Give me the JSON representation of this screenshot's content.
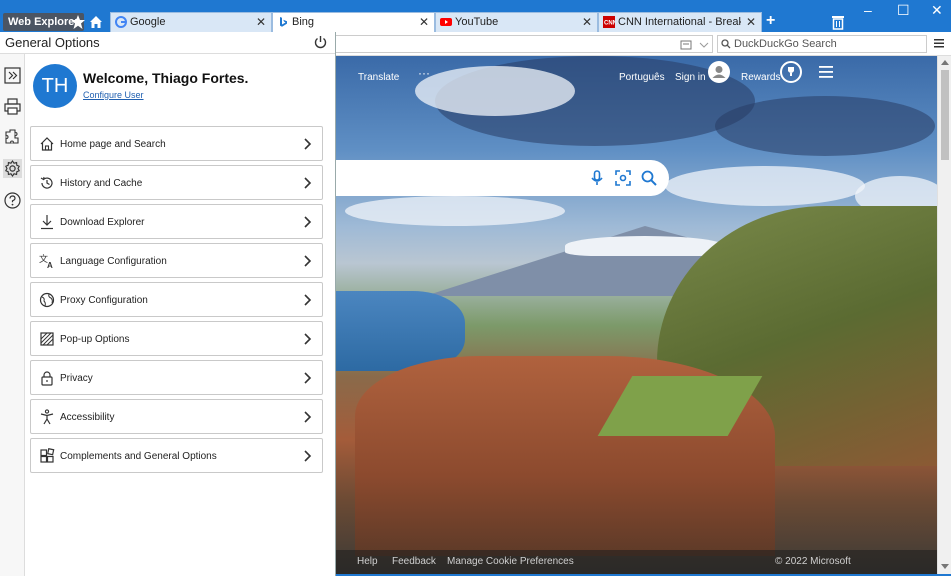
{
  "titlebar": {
    "app_label": "Web Explorer",
    "new_tab": "+",
    "window_controls": [
      "–",
      "☐",
      "✕"
    ]
  },
  "tabs": [
    {
      "label": "Google",
      "favicon": "google-favicon",
      "active": false
    },
    {
      "label": "Bing",
      "favicon": "bing-favicon",
      "active": true
    },
    {
      "label": "YouTube",
      "favicon": "youtube-favicon",
      "active": false
    },
    {
      "label": "CNN International - Breaking News",
      "favicon": "cnn-favicon",
      "active": false
    }
  ],
  "search": {
    "placeholder": "DuckDuckGo Search"
  },
  "bing": {
    "translate": "Translate",
    "more": "···",
    "language": "Português",
    "signin": "Sign in",
    "rewards": "Rewards",
    "footer": [
      "Help",
      "Feedback",
      "Manage Cookie Preferences"
    ],
    "copyright": "© 2022 Microsoft"
  },
  "panel": {
    "title": "General Options",
    "user": {
      "initials": "TH",
      "welcome": "Welcome, Thiago Fortes.",
      "configure": "Configure User"
    },
    "options": [
      {
        "label": "Home page and Search",
        "icon": "home-icon"
      },
      {
        "label": "History and Cache",
        "icon": "history-icon"
      },
      {
        "label": "Download Explorer",
        "icon": "download-icon"
      },
      {
        "label": "Language Configuration",
        "icon": "language-icon"
      },
      {
        "label": "Proxy Configuration",
        "icon": "globe-icon"
      },
      {
        "label": "Pop-up Options",
        "icon": "popup-block-icon"
      },
      {
        "label": "Privacy",
        "icon": "lock-icon"
      },
      {
        "label": "Accessibility",
        "icon": "accessibility-icon"
      },
      {
        "label": "Complements and General Options",
        "icon": "extensions-icon"
      }
    ]
  },
  "colors": {
    "accent": "#1f78d1",
    "tab_inactive": "#d9e7f6",
    "app_label_bg": "#4b5563"
  }
}
